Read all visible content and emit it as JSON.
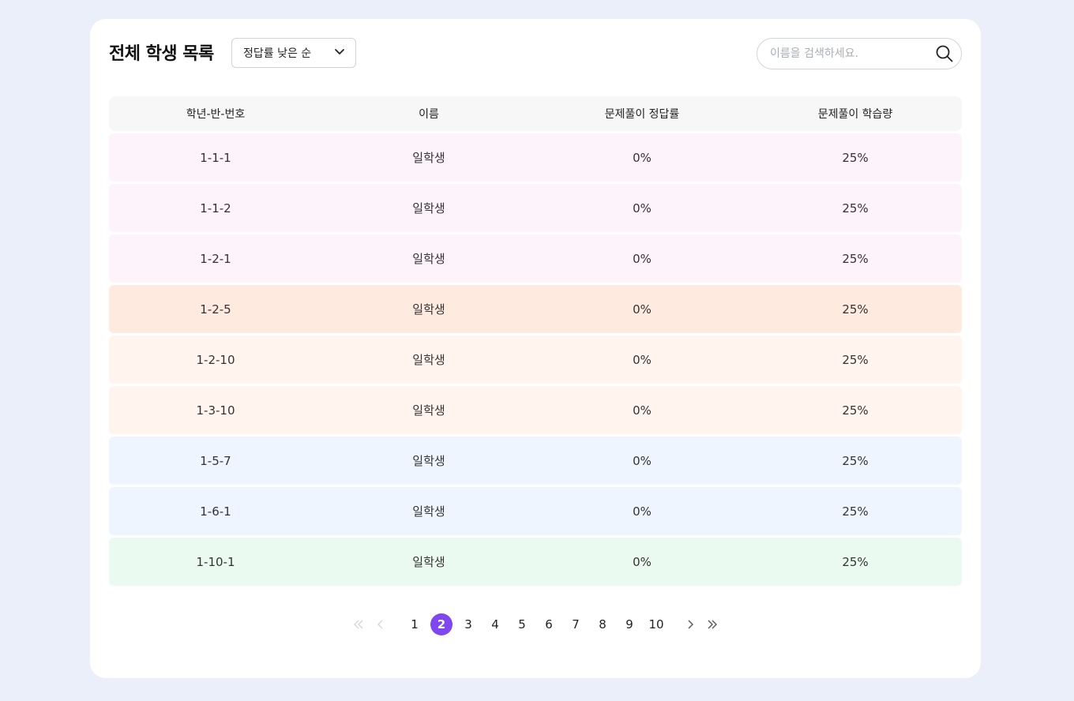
{
  "header": {
    "title": "전체 학생 목록",
    "sort_label": "정답률 낮은 순",
    "search_placeholder": "이름을 검색하세요."
  },
  "table": {
    "columns": [
      "학년-반-번호",
      "이름",
      "문제풀이 정답률",
      "문제풀이 학습량"
    ],
    "rows": [
      {
        "id": "1-1-1",
        "name": "일학생",
        "accuracy": "0%",
        "volume": "25%",
        "color": "#fdf3fb"
      },
      {
        "id": "1-1-2",
        "name": "일학생",
        "accuracy": "0%",
        "volume": "25%",
        "color": "#fdf3fb"
      },
      {
        "id": "1-2-1",
        "name": "일학생",
        "accuracy": "0%",
        "volume": "25%",
        "color": "#fdf3fb"
      },
      {
        "id": "1-2-5",
        "name": "일학생",
        "accuracy": "0%",
        "volume": "25%",
        "color": "#ffeae0"
      },
      {
        "id": "1-2-10",
        "name": "일학생",
        "accuracy": "0%",
        "volume": "25%",
        "color": "#fff4ee"
      },
      {
        "id": "1-3-10",
        "name": "일학생",
        "accuracy": "0%",
        "volume": "25%",
        "color": "#fff4ee"
      },
      {
        "id": "1-5-7",
        "name": "일학생",
        "accuracy": "0%",
        "volume": "25%",
        "color": "#eef5fe"
      },
      {
        "id": "1-6-1",
        "name": "일학생",
        "accuracy": "0%",
        "volume": "25%",
        "color": "#eef5fe"
      },
      {
        "id": "1-10-1",
        "name": "일학생",
        "accuracy": "0%",
        "volume": "25%",
        "color": "#ebfaf1"
      }
    ]
  },
  "pagination": {
    "pages": [
      "1",
      "2",
      "3",
      "4",
      "5",
      "6",
      "7",
      "8",
      "9",
      "10"
    ],
    "current": "2",
    "accent": "#8046f0"
  },
  "icons": {
    "sort_toggle": "chevron-down-icon",
    "search": "search-icon",
    "first": "double-chevron-left-icon",
    "prev": "chevron-left-icon",
    "next": "chevron-right-icon",
    "last": "double-chevron-right-icon"
  }
}
